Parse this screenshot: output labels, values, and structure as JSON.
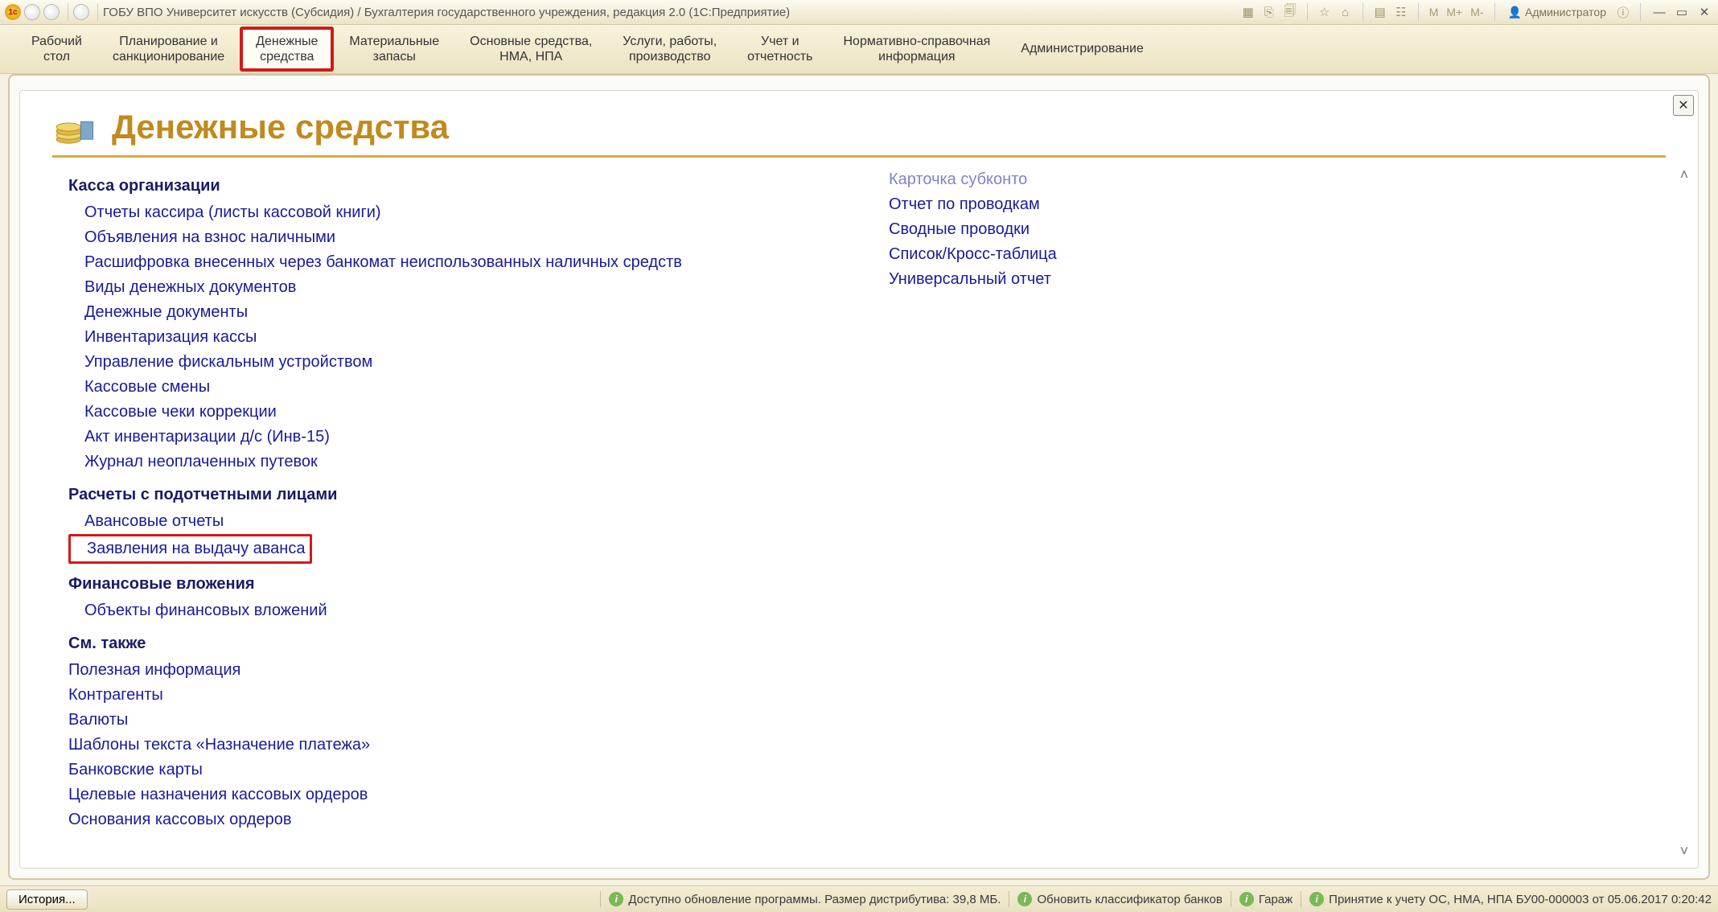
{
  "titlebar": {
    "title": "ГОБУ ВПО Университет искусств (Субсидия) / Бухгалтерия государственного учреждения, редакция 2.0  (1С:Предприятие)",
    "m": "M",
    "mplus": "M+",
    "mminus": "M-",
    "admin": "Администратор"
  },
  "sections": [
    {
      "l1": "Рабочий",
      "l2": "стол"
    },
    {
      "l1": "Планирование и",
      "l2": "санкционирование"
    },
    {
      "l1": "Денежные",
      "l2": "средства"
    },
    {
      "l1": "Материальные",
      "l2": "запасы"
    },
    {
      "l1": "Основные средства,",
      "l2": "НМА, НПА"
    },
    {
      "l1": "Услуги, работы,",
      "l2": "производство"
    },
    {
      "l1": "Учет и",
      "l2": "отчетность"
    },
    {
      "l1": "Нормативно-справочная",
      "l2": "информация"
    },
    {
      "l1": "Администрирование",
      "l2": ""
    }
  ],
  "page": {
    "title": "Денежные средства"
  },
  "left": {
    "g1": {
      "title": "Касса организации",
      "items": [
        "Отчеты кассира (листы кассовой книги)",
        "Объявления на взнос наличными",
        "Расшифровка внесенных через банкомат неиспользованных наличных средств",
        "Виды денежных документов",
        "Денежные документы",
        "Инвентаризация кассы",
        "Управление фискальным устройством",
        "Кассовые смены",
        "Кассовые чеки коррекции",
        "Акт инвентаризации д/с (Инв-15)",
        "Журнал неоплаченных путевок"
      ]
    },
    "g2": {
      "title": "Расчеты с подотчетными лицами",
      "items": [
        "Авансовые отчеты",
        "Заявления на выдачу аванса"
      ]
    },
    "g3": {
      "title": "Финансовые вложения",
      "items": [
        "Объекты финансовых вложений"
      ]
    },
    "g4": {
      "title": "См. также",
      "items": [
        "Полезная информация",
        "Контрагенты",
        "Валюты",
        "Шаблоны текста «Назначение платежа»",
        "Банковские карты",
        "Целевые назначения кассовых ордеров",
        "Основания кассовых ордеров"
      ]
    }
  },
  "right": {
    "cut": "Карточка субконто",
    "items": [
      "Отчет по проводкам",
      "Сводные проводки",
      "Список/Кросс-таблица",
      "Универсальный отчет"
    ]
  },
  "status": {
    "history": "История...",
    "s1": "Доступно обновление программы. Размер дистрибутива: 39,8 МБ.",
    "s2": "Обновить классификатор банков",
    "s3": "Гараж",
    "s4": "Принятие к учету ОС, НМА, НПА БУ00-000003 от 05.06.2017 0:20:42"
  }
}
